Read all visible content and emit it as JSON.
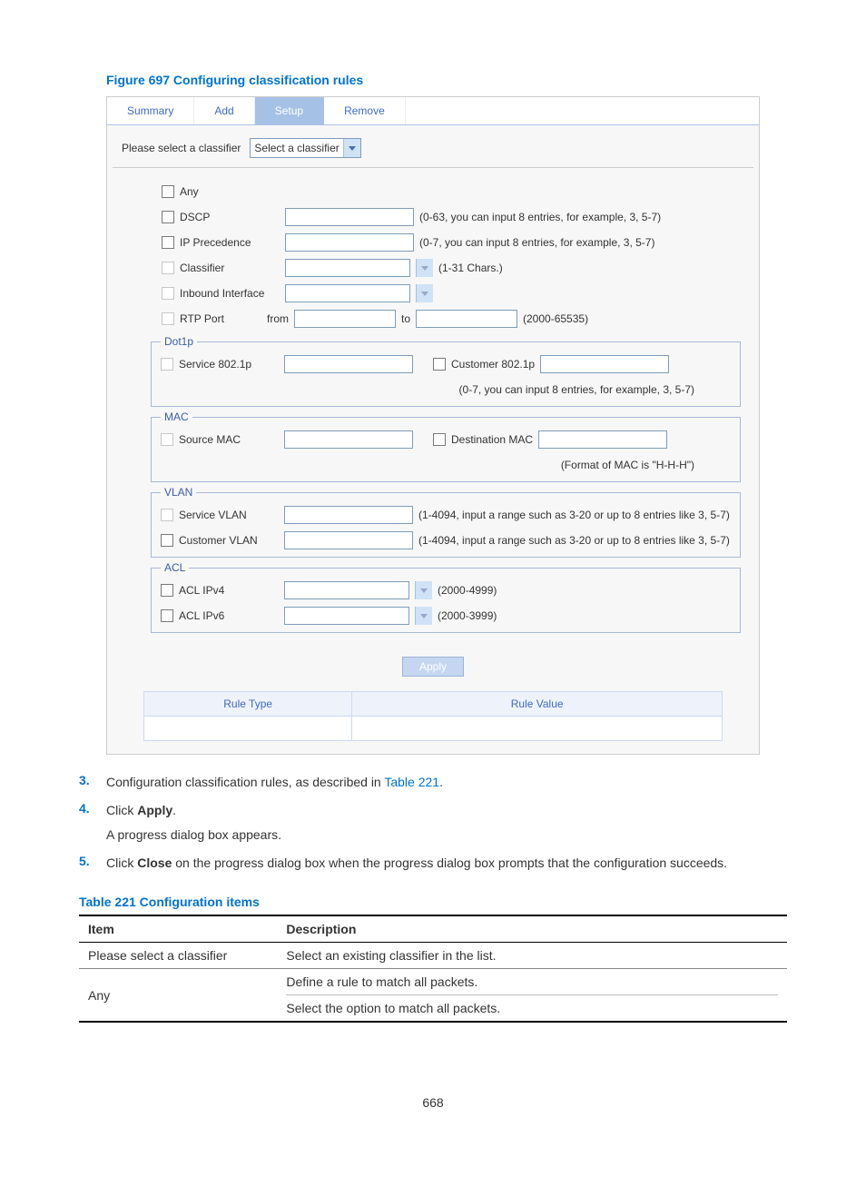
{
  "figure_title": "Figure 697 Configuring classification rules",
  "tabs": {
    "summary": "Summary",
    "add": "Add",
    "setup": "Setup",
    "remove": "Remove"
  },
  "selector": {
    "label": "Please select a classifier",
    "value": "Select a classifier"
  },
  "form": {
    "any": "Any",
    "dscp": {
      "label": "DSCP",
      "hint": "(0-63, you can input 8 entries, for example, 3, 5-7)"
    },
    "ipprec": {
      "label": "IP Precedence",
      "hint": "(0-7, you can input 8 entries, for example, 3, 5-7)"
    },
    "classifier": {
      "label": "Classifier",
      "hint": "(1-31 Chars.)"
    },
    "inbound": {
      "label": "Inbound Interface"
    },
    "rtp": {
      "label": "RTP Port",
      "from": "from",
      "to": "to",
      "hint": "(2000-65535)"
    },
    "dot1p": {
      "legend": "Dot1p",
      "service": "Service 802.1p",
      "customer": "Customer 802.1p",
      "hint": "(0-7, you can input 8 entries, for example, 3, 5-7)"
    },
    "mac": {
      "legend": "MAC",
      "src": "Source MAC",
      "dst": "Destination MAC",
      "hint": "(Format of MAC is \"H-H-H\")"
    },
    "vlan": {
      "legend": "VLAN",
      "service": "Service VLAN",
      "customer": "Customer VLAN",
      "hint": "(1-4094, input a range such as 3-20 or up to 8 entries like 3, 5-7)"
    },
    "acl": {
      "legend": "ACL",
      "v4": "ACL IPv4",
      "v4hint": "(2000-4999)",
      "v6": "ACL IPv6",
      "v6hint": "(2000-3999)"
    },
    "apply": "Apply"
  },
  "rules_header": {
    "type": "Rule Type",
    "value": "Rule Value"
  },
  "steps": {
    "s3": {
      "num": "3.",
      "before": "Configuration classification rules, as described in ",
      "link": "Table 221",
      "after": "."
    },
    "s4": {
      "num": "4.",
      "text": "Click ",
      "bold": "Apply",
      "after": ".",
      "sub": "A progress dialog box appears."
    },
    "s5": {
      "num": "5.",
      "before": "Click ",
      "bold": "Close",
      "after": " on the progress dialog box when the progress dialog box prompts that the configuration succeeds."
    }
  },
  "table_title": "Table 221 Configuration items",
  "config_table": {
    "h1": "Item",
    "h2": "Description",
    "r1c1": "Please select a classifier",
    "r1c2": "Select an existing classifier in the list.",
    "r2c1": "Any",
    "r2c2a": "Define a rule to match all packets.",
    "r2c2b": "Select the option to match all packets."
  },
  "page_num": "668"
}
